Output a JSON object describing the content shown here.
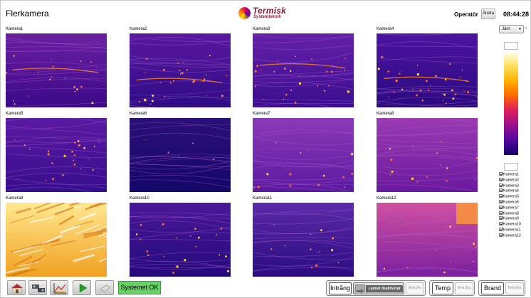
{
  "header": {
    "title": "Flerkamera",
    "logo_main": "Termisk",
    "logo_sub": "Systemteknik",
    "operator_label": "Operatör",
    "change_button": "Ändra",
    "clock": "08:44:28"
  },
  "cameras": [
    {
      "label": "Kamera1"
    },
    {
      "label": "Kamera2"
    },
    {
      "label": "Kamera3"
    },
    {
      "label": "Kamera4"
    },
    {
      "label": "Kamera5"
    },
    {
      "label": "Kamera6"
    },
    {
      "label": "Kamera7"
    },
    {
      "label": "Kamera8"
    },
    {
      "label": "Kamera9"
    },
    {
      "label": "Kamera10"
    },
    {
      "label": "Kamera11"
    },
    {
      "label": "Kamera12"
    }
  ],
  "palette_select": {
    "value": "Järn"
  },
  "camera_checklist": [
    {
      "label": "Kamera1",
      "checked": true
    },
    {
      "label": "Kamera2",
      "checked": true
    },
    {
      "label": "Kamera3",
      "checked": true
    },
    {
      "label": "Kamera4",
      "checked": true
    },
    {
      "label": "Kamera5",
      "checked": true
    },
    {
      "label": "Kamera6",
      "checked": true
    },
    {
      "label": "Kamera7",
      "checked": true
    },
    {
      "label": "Kamera8",
      "checked": true
    },
    {
      "label": "Kamera9",
      "checked": true
    },
    {
      "label": "Kamera10",
      "checked": true
    },
    {
      "label": "Kamera11",
      "checked": true
    },
    {
      "label": "Kamera12",
      "checked": true
    }
  ],
  "toolbar": {
    "status": "Systemet OK"
  },
  "alarms": {
    "intrusion": "Intrång",
    "disarmed": "Larmet deaktiverat",
    "ack": "Bekräfta",
    "temp": "Temp",
    "fire": "Brand"
  },
  "colors": {
    "status_ok": "#66d266",
    "ironbow_hot": "#ffe46a",
    "ironbow_cold": "#12006a"
  }
}
